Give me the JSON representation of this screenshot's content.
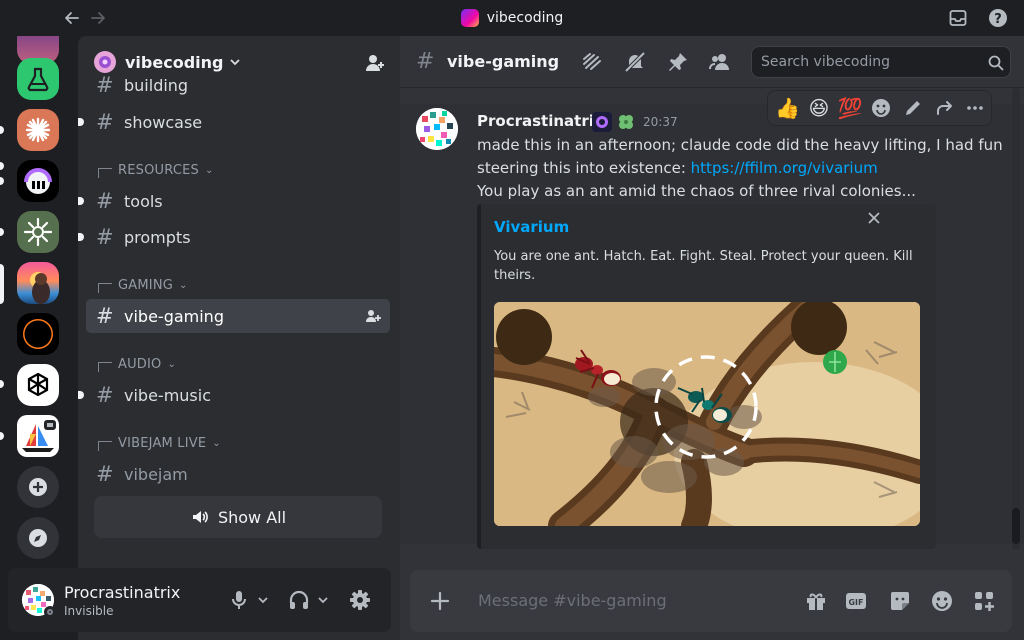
{
  "titlebar": {
    "title": "vibecoding",
    "back_icon": "arrow-left-icon",
    "forward_icon": "arrow-right-icon",
    "inbox_icon": "inbox-icon",
    "help_icon": "help-icon"
  },
  "rail": {
    "servers": [
      {
        "name": "science-flask-server",
        "icon": "flask-icon",
        "color": "#2dc770"
      },
      {
        "name": "sparkle-server",
        "icon": "claude-sparkle-icon",
        "color": "#d97757"
      },
      {
        "name": "piano-skull-server",
        "icon": "headphones-face-icon",
        "color": "#000000"
      },
      {
        "name": "sunburst-server",
        "icon": "sunburst-icon",
        "color": "#56704f"
      },
      {
        "name": "vibecoding-server",
        "icon": "sunset-avatar-icon",
        "color": "#f45a9b"
      },
      {
        "name": "eclipse-server",
        "icon": "eclipse-icon",
        "color": "#000000"
      },
      {
        "name": "openai-server",
        "icon": "openai-knot-icon",
        "color": "#ffffff"
      },
      {
        "name": "sailboat-server",
        "icon": "sailboat-icon",
        "color": "#ffffff"
      }
    ],
    "add_server_icon": "plus-icon",
    "discover_icon": "compass-icon"
  },
  "sidebar": {
    "guild_name": "vibecoding",
    "channels": [
      {
        "label": "building",
        "type": "text"
      },
      {
        "label": "showcase",
        "type": "text"
      },
      {
        "label": "tools",
        "type": "text"
      },
      {
        "label": "prompts",
        "type": "text"
      },
      {
        "label": "vibe-gaming",
        "type": "text"
      },
      {
        "label": "vibe-music",
        "type": "text"
      },
      {
        "label": "vibejam",
        "type": "text"
      }
    ],
    "categories": [
      "RESOURCES",
      "GAMING",
      "AUDIO",
      "VIBEJAM LIVE"
    ],
    "show_all": "Show All"
  },
  "user": {
    "name": "Procrastinatrix",
    "status": "Invisible"
  },
  "channel_header": {
    "name": "vibe-gaming",
    "search_placeholder": "Search vibecoding"
  },
  "message": {
    "author": "Procrastinatrix",
    "time": "20:37",
    "line1": "made this in an afternoon; claude code did the heavy lifting, I had fun",
    "line2_prefix": "steering this into existence: ",
    "link": "https://ffilm.org/vivarium",
    "line3": "You play as an ant amid the chaos of three rival colonies...",
    "reactions": [
      "👍",
      "😆",
      "💯"
    ],
    "embed": {
      "title": "Vivarium",
      "description": "You are one ant. Hatch. Eat. Fight. Steal. Protect your queen. Kill theirs."
    }
  },
  "composer": {
    "placeholder": "Message #vibe-gaming",
    "gif_label": "GIF"
  },
  "colors": {
    "bg": "#1e1f22",
    "sidebar": "#2b2d31",
    "main": "#313338",
    "link": "#00a8fc",
    "active_channel": "#404249"
  }
}
